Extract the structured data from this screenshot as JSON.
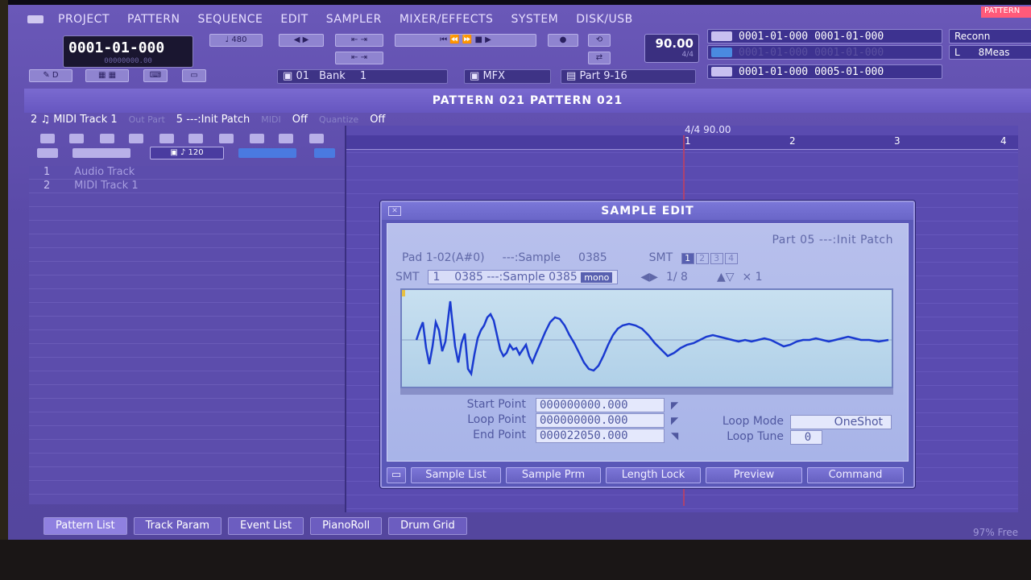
{
  "menu": [
    "PROJECT",
    "PATTERN",
    "SEQUENCE",
    "EDIT",
    "SAMPLER",
    "MIXER/EFFECTS",
    "SYSTEM",
    "DISK/USB"
  ],
  "top_badge": "PATTERN",
  "counter": {
    "main": "0001-01-000",
    "sub": "00000000.00"
  },
  "resolution": "480",
  "tempo": {
    "value": "90.00",
    "sub": "4/4"
  },
  "locators": {
    "loop": {
      "start": "0001-01-000",
      "end": "0001-01-000"
    },
    "punch": {
      "start": "0001-01-000",
      "end": "0001-01-000"
    },
    "length": {
      "start": "0001-01-000",
      "end": "0005-01-000"
    }
  },
  "reconnect": "Reconn",
  "meas": {
    "label": "L",
    "value": "8Meas"
  },
  "bank": {
    "label": "01",
    "name": "Bank",
    "value": "1"
  },
  "mfx": "MFX",
  "part_range": "Part 9-16",
  "pattern_header": "PATTERN  021  PATTERN 021",
  "track_bar": {
    "track": "2  ♫ MIDI Track  1",
    "out_part_label": "Out Part",
    "patch": "5 ---:Init Patch",
    "midi_label": "MIDI",
    "midi_value": "Off",
    "quantize_label": "Quantize",
    "quantize_value": "Off"
  },
  "zoom": "120",
  "tracks": [
    {
      "num": "1",
      "name": "Audio Track"
    },
    {
      "num": "2",
      "name": "MIDI Track 1"
    }
  ],
  "ruler": {
    "signature": "4/4 90.00",
    "marks": [
      "1",
      "2",
      "3",
      "4"
    ]
  },
  "bottom_tabs": [
    "Pattern List",
    "Track Param",
    "Event List",
    "PianoRoll",
    "Drum Grid"
  ],
  "free": "97% Free",
  "dialog": {
    "title": "SAMPLE EDIT",
    "part": "Part 05 ---:Init Patch",
    "pad": "Pad 1-02(A#0)",
    "pad_sample": "---:Sample",
    "pad_sample_no": "0385",
    "smt_label": "SMT",
    "smt_chips": [
      "1",
      "2",
      "3",
      "4"
    ],
    "smt_num": "1",
    "smt_sample": "0385 ---:Sample 0385",
    "mono": "mono",
    "zoom_h": "1/ 8",
    "zoom_v": "× 1",
    "start_label": "Start Point",
    "start_value": "000000000.000",
    "loop_label": "Loop Point",
    "loop_value": "000000000.000",
    "end_label": "End Point",
    "end_value": "000022050.000",
    "loop_mode_label": "Loop Mode",
    "loop_mode_value": "OneShot",
    "loop_tune_label": "Loop Tune",
    "loop_tune_value": "0",
    "buttons": [
      "Sample List",
      "Sample Prm",
      "Length Lock",
      "Preview",
      "Command"
    ]
  },
  "colors": {
    "accent": "#5a4aa8",
    "dialog": "#a8b4e8",
    "wave": "#1a3ad0"
  }
}
